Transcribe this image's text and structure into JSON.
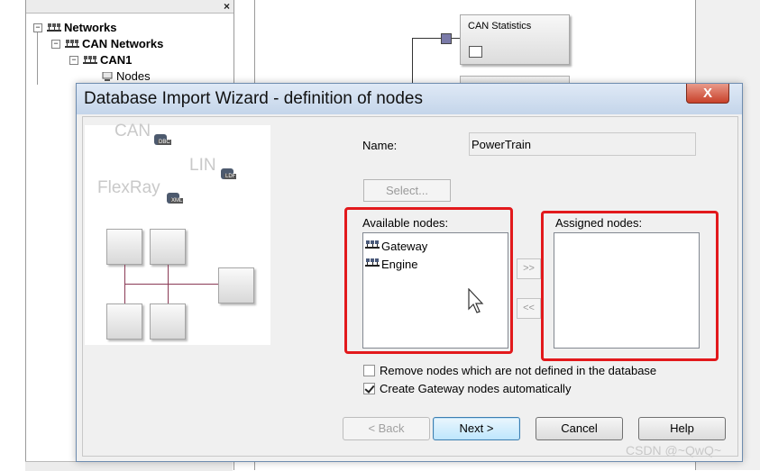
{
  "tree": {
    "nodes": [
      "Networks",
      "CAN Networks",
      "CAN1",
      "Nodes"
    ],
    "close_glyph": "×"
  },
  "graph": {
    "block_title": "CAN Statistics"
  },
  "dialog": {
    "title": "Database Import Wizard - definition of nodes",
    "close_glyph": "X",
    "preview": {
      "labels": [
        "CAN",
        "LIN",
        "FlexRay"
      ],
      "db_tags": [
        "DBC",
        "LDF",
        "XML"
      ]
    },
    "name_label": "Name:",
    "name_value": "PowerTrain",
    "select_label": "Select...",
    "available_label": "Available nodes:",
    "available_nodes": [
      "Gateway",
      "Engine"
    ],
    "assigned_label": "Assigned nodes:",
    "assigned_nodes": [],
    "add_label": ">>",
    "remove_label": "<<",
    "option_remove": {
      "label": "Remove nodes which are not defined in the database",
      "checked": false
    },
    "option_gateway": {
      "label": "Create Gateway nodes automatically",
      "checked": true
    },
    "buttons": {
      "back": "< Back",
      "next": "Next >",
      "cancel": "Cancel",
      "help": "Help"
    }
  },
  "watermark": "CSDN @~QwQ~",
  "colors": {
    "highlight": "#e2191c",
    "titlebar": "#c4d5ea",
    "close": "#c8412a"
  }
}
